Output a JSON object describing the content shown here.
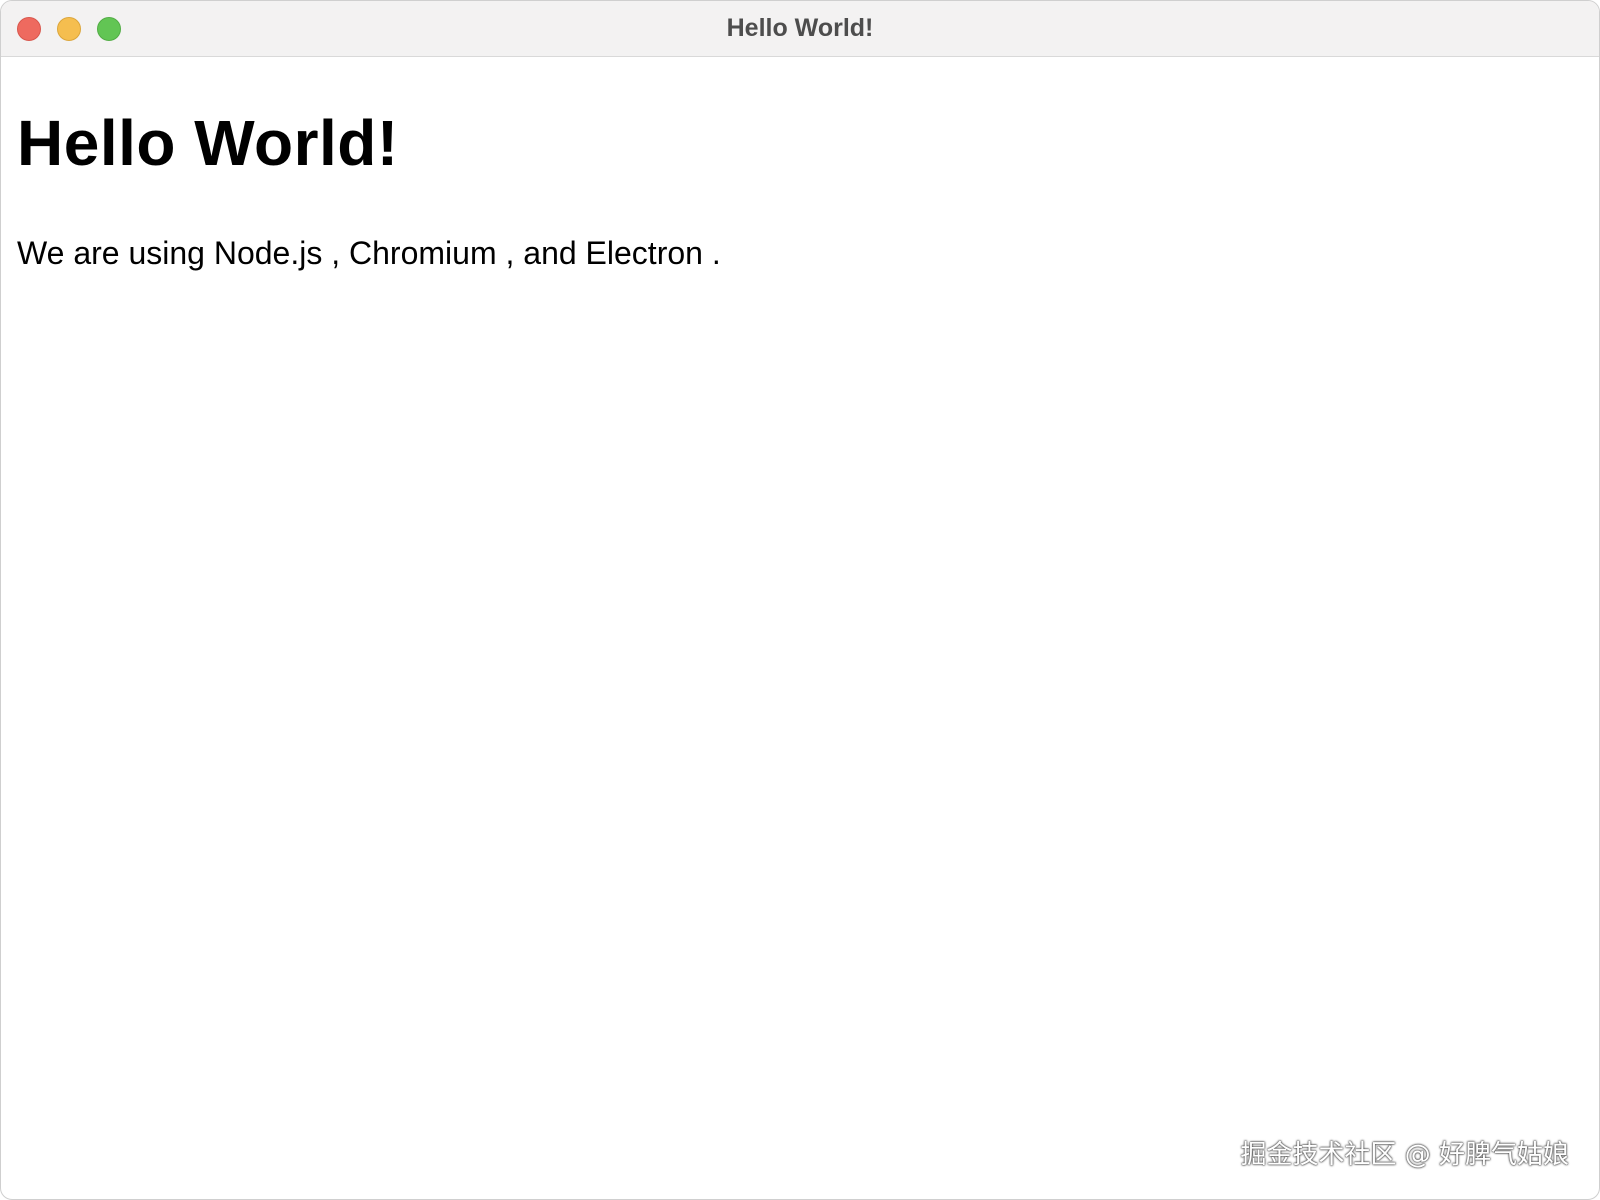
{
  "window": {
    "title": "Hello World!"
  },
  "page": {
    "heading": "Hello World!",
    "paragraph": {
      "prefix": "We are using ",
      "node": "Node.js",
      "sep1": " , ",
      "chromium": "Chromium",
      "sep2": " , and ",
      "electron": "Electron",
      "suffix": " ."
    }
  },
  "watermark": {
    "text": "掘金技术社区 @ 好脾气姑娘"
  },
  "colors": {
    "close": "#ee6a5f",
    "minimize": "#f5be4f",
    "zoom": "#62c554",
    "titlebar": "#f3f2f2"
  }
}
